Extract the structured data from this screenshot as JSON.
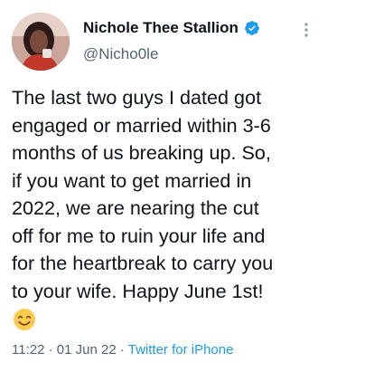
{
  "author": {
    "display_name": "Nichole Thee Stallion",
    "handle": "@Nicho0le",
    "verified": true,
    "verified_color": "#1d9bf0",
    "avatar_icon": "profile-photo"
  },
  "tweet": {
    "text": "The last two guys I dated got\nengaged or married within 3-6\nmonths of us breaking up. So,\nif you want to get married in\n2022, we are nearing the cut\noff for me to ruin your life and\nfor the heartbreak to carry you\nto your wife. Happy June 1st!",
    "emoji": "smiling-face-with-smiling-eyes"
  },
  "meta": {
    "time": "11:22",
    "separator": " · ",
    "date": "01 Jun 22",
    "source": "Twitter for iPhone"
  },
  "colors": {
    "text": "#0f1419",
    "secondary": "#536471",
    "link": "#1d9bf0"
  }
}
